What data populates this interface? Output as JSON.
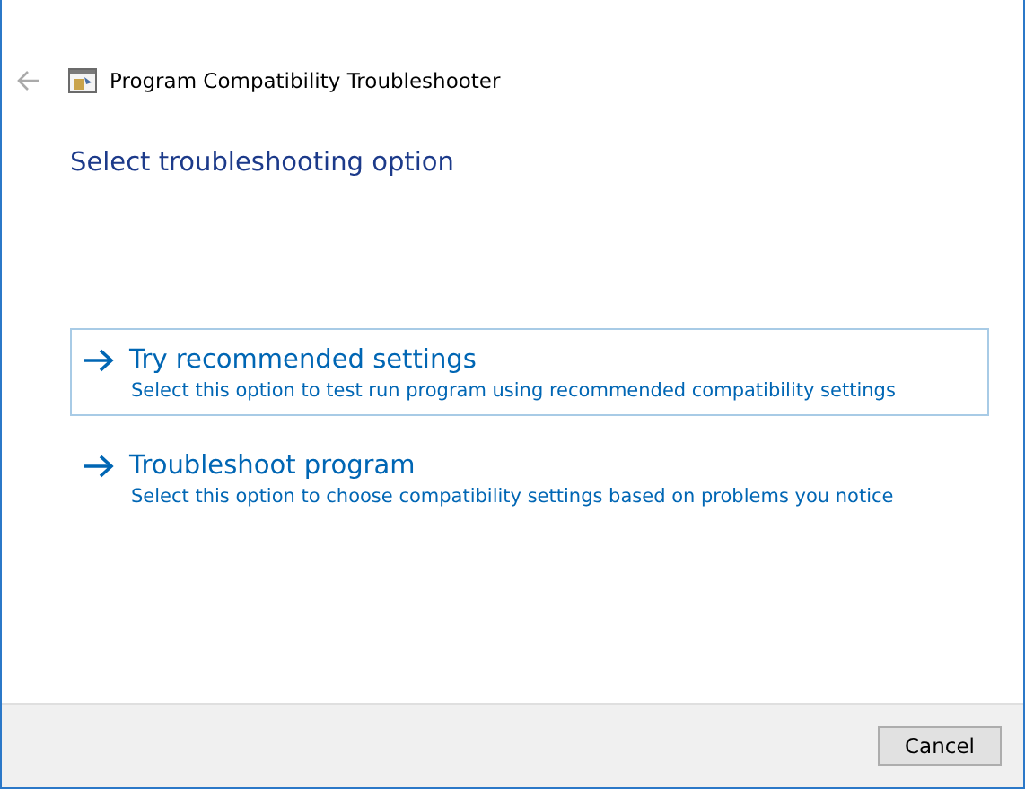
{
  "window": {
    "title": "Program Compatibility Troubleshooter",
    "back_enabled": false
  },
  "heading": "Select troubleshooting option",
  "options": [
    {
      "title": "Try recommended settings",
      "description": "Select this option to test run program using recommended compatibility settings",
      "selected": true
    },
    {
      "title": "Troubleshoot program",
      "description": "Select this option to choose compatibility settings based on problems you notice",
      "selected": false
    }
  ],
  "buttons": [
    "Cancel"
  ]
}
